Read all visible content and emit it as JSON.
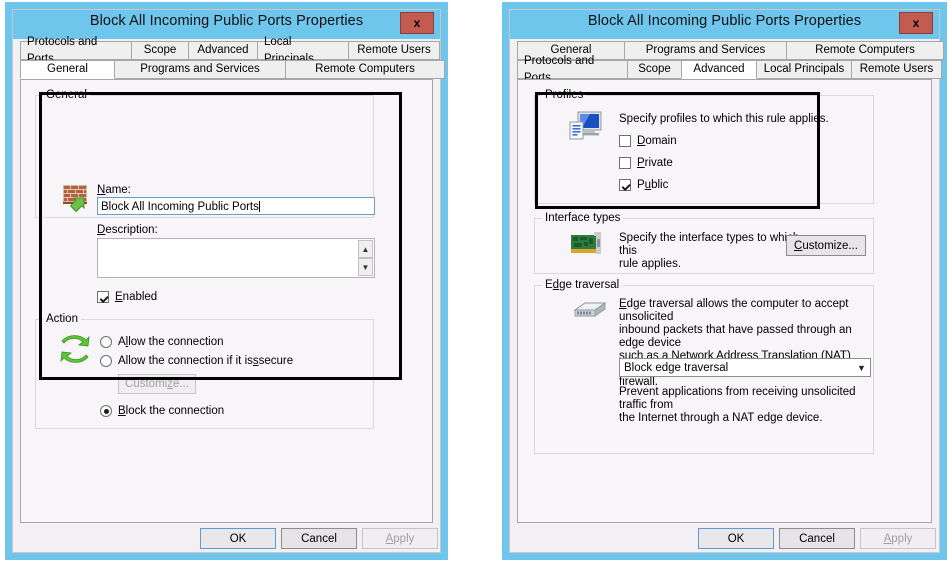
{
  "windows": [
    {
      "title": "Block All Incoming Public Ports Properties",
      "close_label": "x",
      "tabs_top": [
        {
          "label": "Protocols and Ports",
          "active": false
        },
        {
          "label": "Scope",
          "active": false
        },
        {
          "label": "Advanced",
          "active": false
        },
        {
          "label": "Local Principals",
          "active": false
        },
        {
          "label": "Remote Users",
          "active": false
        }
      ],
      "tabs_bottom": [
        {
          "label": "General",
          "active": true
        },
        {
          "label": "Programs and Services",
          "active": false
        },
        {
          "label": "Remote Computers",
          "active": false
        }
      ],
      "general_group": {
        "title": "General",
        "name_label": "Name:",
        "name_value": "Block All Incoming Public Ports",
        "description_label": "Description:",
        "description_value": "",
        "enabled_label": "Enabled",
        "enabled_checked": true
      },
      "action_group": {
        "title": "Action",
        "options": [
          {
            "label": "Allow the connection",
            "selected": false
          },
          {
            "label": "Allow the connection if it is secure",
            "selected": false
          },
          {
            "label": "Block the connection",
            "selected": true
          }
        ],
        "customize_label": "Customize...",
        "customize_disabled": true
      },
      "footer": {
        "ok": "OK",
        "cancel": "Cancel",
        "apply": "Apply",
        "apply_disabled": true
      }
    },
    {
      "title": "Block All Incoming Public Ports Properties",
      "close_label": "x",
      "tabs_top": [
        {
          "label": "General",
          "active": false
        },
        {
          "label": "Programs and Services",
          "active": false
        },
        {
          "label": "Remote Computers",
          "active": false
        }
      ],
      "tabs_bottom": [
        {
          "label": "Protocols and Ports",
          "active": false
        },
        {
          "label": "Scope",
          "active": false
        },
        {
          "label": "Advanced",
          "active": true
        },
        {
          "label": "Local Principals",
          "active": false
        },
        {
          "label": "Remote Users",
          "active": false
        }
      ],
      "profiles_group": {
        "title": "Profiles",
        "description": "Specify profiles to which this rule applies.",
        "items": [
          {
            "label": "Domain",
            "checked": false
          },
          {
            "label": "Private",
            "checked": false
          },
          {
            "label": "Public",
            "checked": true
          }
        ]
      },
      "interface_group": {
        "title": "Interface types",
        "description_line1": "Specify the interface types to which this",
        "description_line2": "rule applies.",
        "customize_label": "Customize..."
      },
      "edge_group": {
        "title": "Edge traversal",
        "description_line1": "Edge traversal allows the computer to accept unsolicited",
        "description_line2": "inbound packets that have passed through an edge device",
        "description_line3": "such as a Network Address Translation (NAT) router or",
        "description_line4": "firewall.",
        "combo_value": "Block edge traversal",
        "hint_line1": "Prevent applications from receiving unsolicited traffic from",
        "hint_line2": "the Internet through a NAT edge device."
      },
      "footer": {
        "ok": "OK",
        "cancel": "Cancel",
        "apply": "Apply",
        "apply_disabled": true
      }
    }
  ],
  "colors": {
    "window_frame": "#6ec6ec",
    "close_button": "#c45b50",
    "panel_bg": "#f7f5f7",
    "highlight_box": "#000000",
    "default_button_border": "#5b9bd5"
  }
}
